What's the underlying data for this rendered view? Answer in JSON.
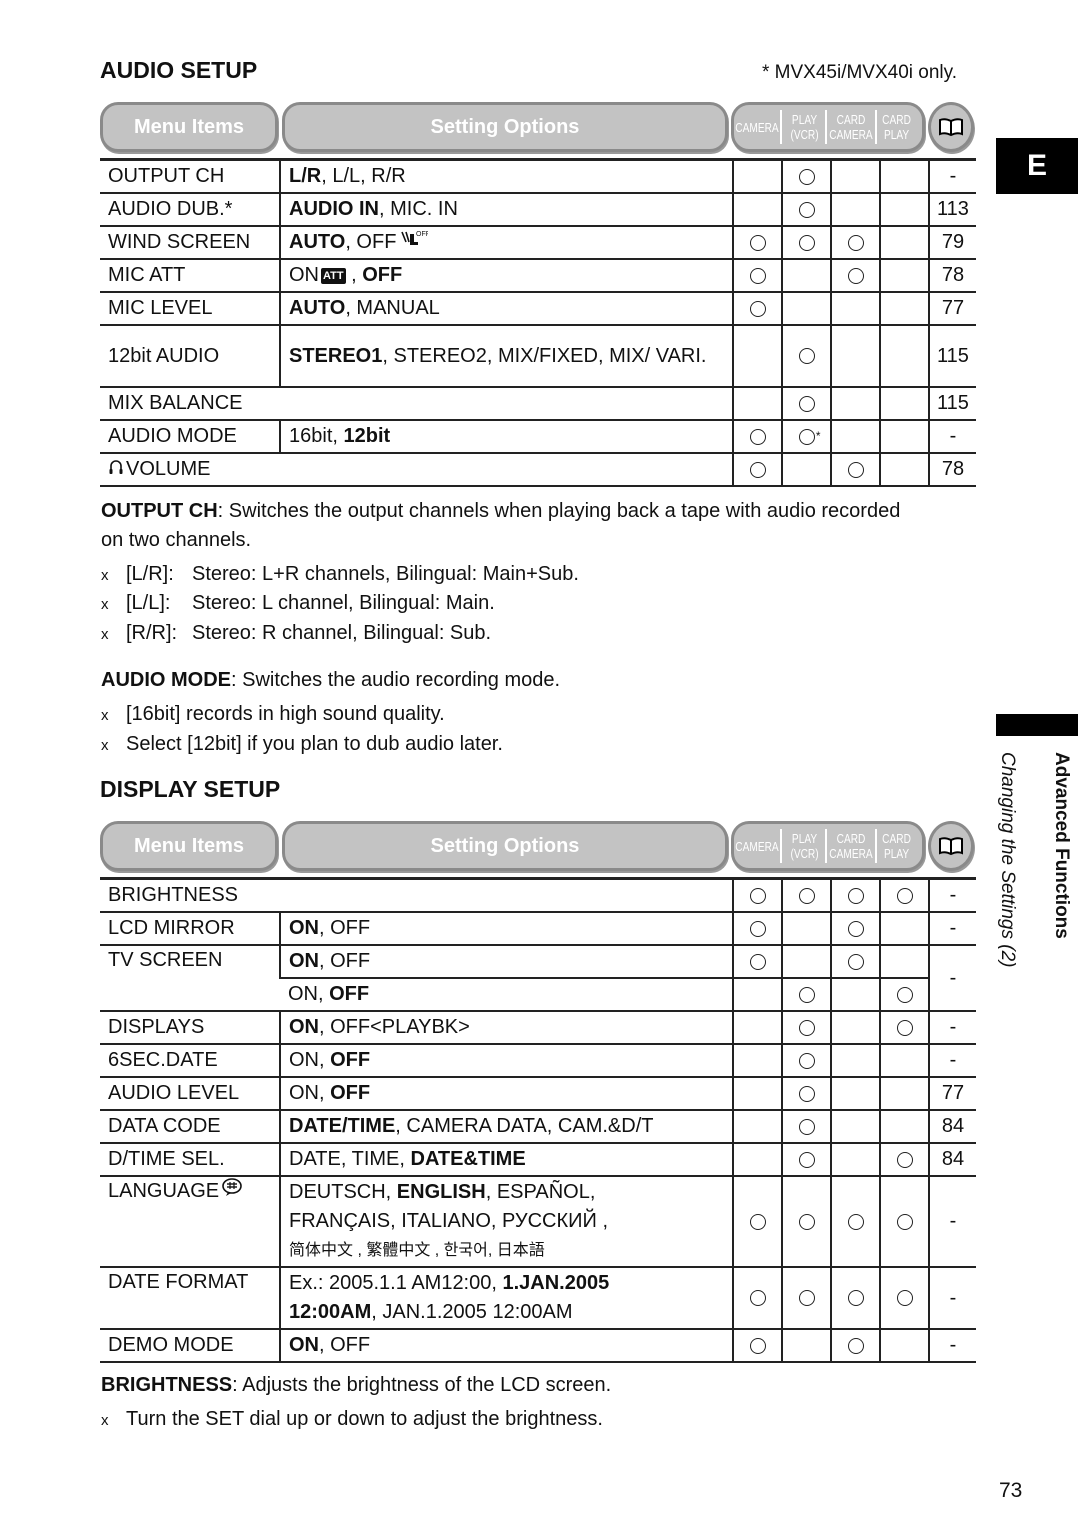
{
  "page": {
    "side_tab": "E",
    "chapter": "Advanced Functions",
    "section": "Changing the Settings (2)",
    "page_number": "73"
  },
  "header_labels": {
    "menu_items": "Menu Items",
    "setting_options": "Setting Options",
    "modes": [
      {
        "line1": "CAMERA",
        "line2": ""
      },
      {
        "line1": "PLAY",
        "line2": "(VCR)"
      },
      {
        "line1": "CARD",
        "line2": "CAMERA"
      },
      {
        "line1": "CARD",
        "line2": "PLAY"
      }
    ],
    "reference_icon": "book-icon"
  },
  "audio_setup": {
    "title": "AUDIO SETUP",
    "footnote": "* MVX45i/MVX40i only.",
    "rows": [
      {
        "item": "OUTPUT CH",
        "options": [
          {
            "t": "L/R",
            "b": true
          },
          {
            "t": ", L/L, R/R",
            "b": false
          }
        ],
        "modes": [
          false,
          true,
          false,
          false
        ],
        "page": "-"
      },
      {
        "item": "AUDIO DUB.*",
        "options": [
          {
            "t": "AUDIO IN",
            "b": true
          },
          {
            "t": ", MIC. IN",
            "b": false
          }
        ],
        "modes": [
          false,
          true,
          false,
          false
        ],
        "page": "113"
      },
      {
        "item": "WIND SCREEN",
        "options": [
          {
            "t": "AUTO",
            "b": true
          },
          {
            "t": ", OFF",
            "b": false
          }
        ],
        "option_icon": "wind-screen-off-icon",
        "modes": [
          true,
          true,
          true,
          false
        ],
        "page": "79"
      },
      {
        "item": "MIC ATT",
        "options": [
          {
            "t": "ON",
            "b": false
          }
        ],
        "option_icon": "mic-att-icon",
        "options_after": [
          {
            "t": " , ",
            "b": false
          },
          {
            "t": "OFF",
            "b": true
          }
        ],
        "modes": [
          true,
          false,
          true,
          false
        ],
        "page": "78"
      },
      {
        "item": "MIC LEVEL",
        "options": [
          {
            "t": "AUTO",
            "b": true
          },
          {
            "t": ", MANUAL",
            "b": false
          }
        ],
        "modes": [
          true,
          false,
          false,
          false
        ],
        "page": "77"
      },
      {
        "item": "12bit AUDIO",
        "options": [
          {
            "t": "STEREO1",
            "b": true
          },
          {
            "t": ", STEREO2, MIX/FIXED, MIX/ VARI.",
            "b": false
          }
        ],
        "modes": [
          false,
          true,
          false,
          false
        ],
        "page": "115"
      },
      {
        "item": "MIX BALANCE",
        "span": true,
        "modes": [
          false,
          true,
          false,
          false
        ],
        "page": "115"
      },
      {
        "item": "AUDIO MODE",
        "options": [
          {
            "t": "16bit, ",
            "b": false
          },
          {
            "t": "12bit",
            "b": true
          }
        ],
        "modes": [
          true,
          true,
          false,
          false
        ],
        "mode_notes": [
          "",
          "*",
          "",
          ""
        ],
        "page": "-"
      },
      {
        "item": "VOLUME",
        "item_icon": "headphones-icon",
        "span": true,
        "modes": [
          true,
          false,
          true,
          false
        ],
        "page": "78"
      }
    ],
    "descriptions": [
      {
        "term": "OUTPUT CH",
        "text": ": Switches the output channels when playing back a tape with audio recorded on two channels."
      },
      {
        "term": "AUDIO MODE",
        "text": ": Switches the audio recording mode."
      }
    ],
    "output_bullets": [
      {
        "key": "[L/R]:",
        "text": "Stereo: L+R channels, Bilingual: Main+Sub."
      },
      {
        "key": "[L/L]:",
        "text": "Stereo: L channel, Bilingual: Main."
      },
      {
        "key": "[R/R]:",
        "text": "Stereo: R channel, Bilingual: Sub."
      }
    ],
    "mode_bullets": [
      "[16bit] records in high sound quality.",
      "Select [12bit] if you plan to dub audio later."
    ]
  },
  "display_setup": {
    "title": "DISPLAY SETUP",
    "rows": {
      "brightness": {
        "item": "BRIGHTNESS",
        "modes": [
          true,
          true,
          true,
          true
        ],
        "page": "-"
      },
      "lcd_mirror": {
        "item": "LCD MIRROR",
        "options": [
          {
            "t": "ON",
            "b": true
          },
          {
            "t": ", OFF",
            "b": false
          }
        ],
        "modes": [
          true,
          false,
          true,
          false
        ],
        "page": "-"
      },
      "tv_screen": {
        "item": "TV SCREEN",
        "sub": [
          {
            "options": [
              {
                "t": "ON",
                "b": true
              },
              {
                "t": ", OFF",
                "b": false
              }
            ],
            "modes": [
              true,
              false,
              true,
              false
            ]
          },
          {
            "options": [
              {
                "t": "ON, ",
                "b": false
              },
              {
                "t": "OFF",
                "b": true
              }
            ],
            "modes": [
              false,
              true,
              false,
              true
            ]
          }
        ],
        "page": "-"
      },
      "displays": {
        "item": "DISPLAYS",
        "options": [
          {
            "t": "ON",
            "b": true
          },
          {
            "t": ", OFF<PLAYBK>",
            "b": false
          }
        ],
        "modes": [
          false,
          true,
          false,
          true
        ],
        "page": "-"
      },
      "sec_date": {
        "item": "6SEC.DATE",
        "options": [
          {
            "t": "ON, ",
            "b": false
          },
          {
            "t": "OFF",
            "b": true
          }
        ],
        "modes": [
          false,
          true,
          false,
          false
        ],
        "page": "-"
      },
      "audio_level": {
        "item": "AUDIO LEVEL",
        "options": [
          {
            "t": "ON, ",
            "b": false
          },
          {
            "t": "OFF",
            "b": true
          }
        ],
        "modes": [
          false,
          true,
          false,
          false
        ],
        "page": "77"
      },
      "data_code": {
        "item": "DATA CODE",
        "options": [
          {
            "t": "DATE/TIME",
            "b": true
          },
          {
            "t": ", CAMERA DATA, CAM.&D/T",
            "b": false
          }
        ],
        "modes": [
          false,
          true,
          false,
          false
        ],
        "page": "84"
      },
      "dtime_sel": {
        "item": "D/TIME SEL.",
        "options": [
          {
            "t": "DATE, TIME, ",
            "b": false
          },
          {
            "t": "DATE&TIME",
            "b": true
          }
        ],
        "modes": [
          false,
          true,
          false,
          true
        ],
        "page": "84"
      },
      "language": {
        "item": "LANGUAGE",
        "item_icon": "language-icon",
        "line1": [
          {
            "t": "DEUTSCH, ",
            "b": false
          },
          {
            "t": "ENGLISH",
            "b": true
          },
          {
            "t": ", ESPAÑOL,",
            "b": false
          }
        ],
        "line2": "FRANÇAIS, ITALIANO, РУССКИЙ ,",
        "line3": "简体中文 , 繁體中文 , 한국어, 日本語",
        "modes": [
          true,
          true,
          true,
          true
        ],
        "page": "-"
      },
      "date_format": {
        "item": "DATE FORMAT",
        "line1": [
          {
            "t": "Ex.: 2005.1.1 AM12:00, ",
            "b": false
          },
          {
            "t": "1.JAN.2005",
            "b": true
          }
        ],
        "line2": [
          {
            "t": "12:00AM",
            "b": true
          },
          {
            "t": ", JAN.1.2005 12:00AM",
            "b": false
          }
        ],
        "modes": [
          true,
          true,
          true,
          true
        ],
        "page": "-"
      },
      "demo_mode": {
        "item": "DEMO MODE",
        "options": [
          {
            "t": "ON",
            "b": true
          },
          {
            "t": ", OFF",
            "b": false
          }
        ],
        "modes": [
          true,
          false,
          true,
          false
        ],
        "page": "-"
      }
    },
    "descriptions": [
      {
        "term": "BRIGHTNESS",
        "text": ": Adjusts the brightness of the LCD screen."
      }
    ],
    "bullets": [
      "Turn the SET dial up or down to adjust the brightness."
    ]
  },
  "bullet_glyph": "x"
}
